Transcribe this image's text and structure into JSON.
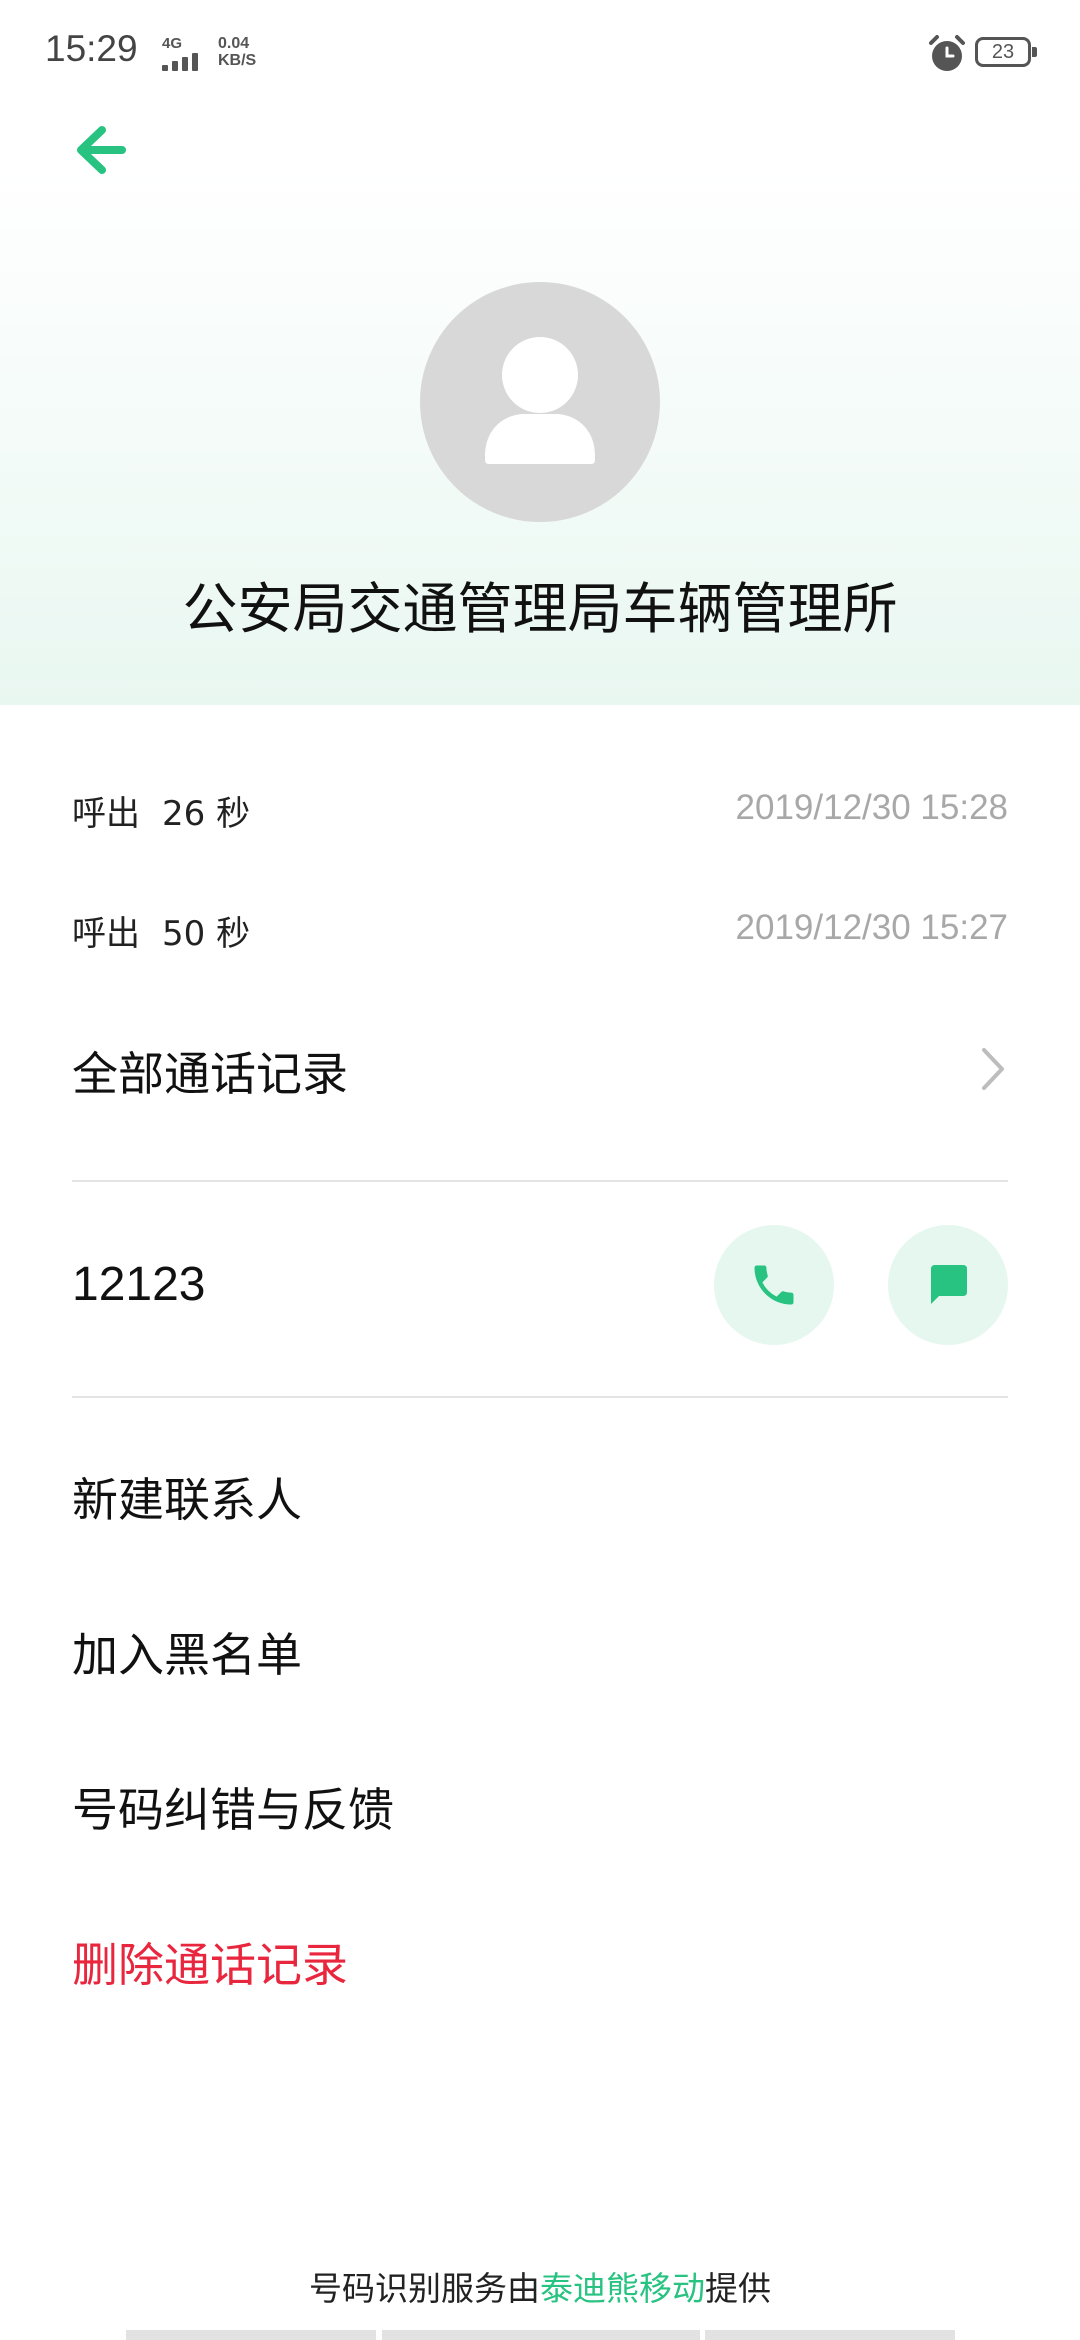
{
  "status_bar": {
    "time": "15:29",
    "network_type": "4G",
    "net_speed_value": "0.04",
    "net_speed_unit": "KB/S",
    "battery_level": "23",
    "icons": [
      "signal-icon",
      "alarm-icon",
      "battery-icon"
    ]
  },
  "header": {
    "back_icon": "arrow-left-icon",
    "avatar_icon": "person-icon",
    "contact_name": "公安局交通管理局车辆管理所"
  },
  "call_log": [
    {
      "type": "呼出",
      "duration": "26 秒",
      "datetime": "2019/12/30 15:28"
    },
    {
      "type": "呼出",
      "duration": "50 秒",
      "datetime": "2019/12/30 15:27"
    }
  ],
  "all_calls": {
    "label": "全部通话记录",
    "icon": "chevron-right-icon"
  },
  "phone": {
    "number": "12123",
    "call_icon": "phone-icon",
    "message_icon": "message-icon"
  },
  "actions": {
    "new_contact": "新建联系人",
    "add_blacklist": "加入黑名单",
    "report_error": "号码纠错与反馈",
    "delete_log": "删除通话记录"
  },
  "footer": {
    "prefix": "号码识别服务由",
    "brand": "泰迪熊移动",
    "suffix": "提供"
  },
  "colors": {
    "accent": "#28c281",
    "danger": "#e8273f",
    "action_bg": "#e5f7ee",
    "header_gradient_end": "#e9f7f1",
    "secondary_text": "#a8a8a8"
  }
}
